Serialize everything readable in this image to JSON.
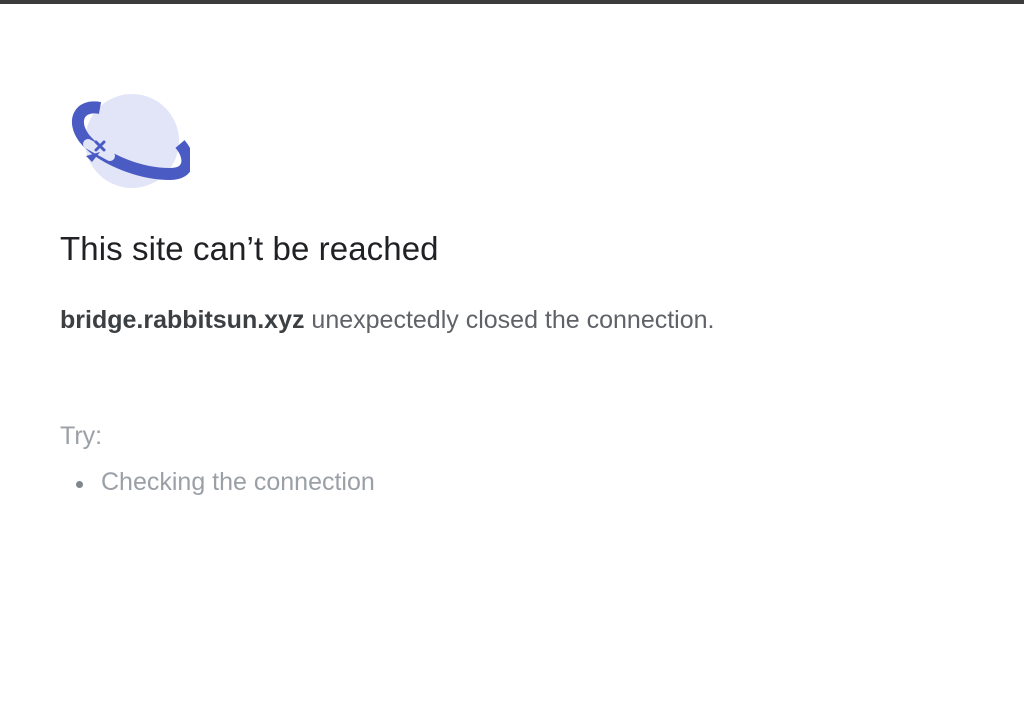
{
  "page": {
    "icon": "disconnected-planet-icon",
    "title": "This site can’t be reached",
    "host": "bridge.rabbitsun.xyz",
    "message": " unexpectedly closed the connection.",
    "try_label": "Try:",
    "suggestions": [
      "Checking the connection"
    ]
  },
  "colors": {
    "icon_primary": "#4a5bc4",
    "icon_light": "#e1e5f7",
    "title": "#202124",
    "body": "#5f6368",
    "muted": "#9aa0a6"
  }
}
